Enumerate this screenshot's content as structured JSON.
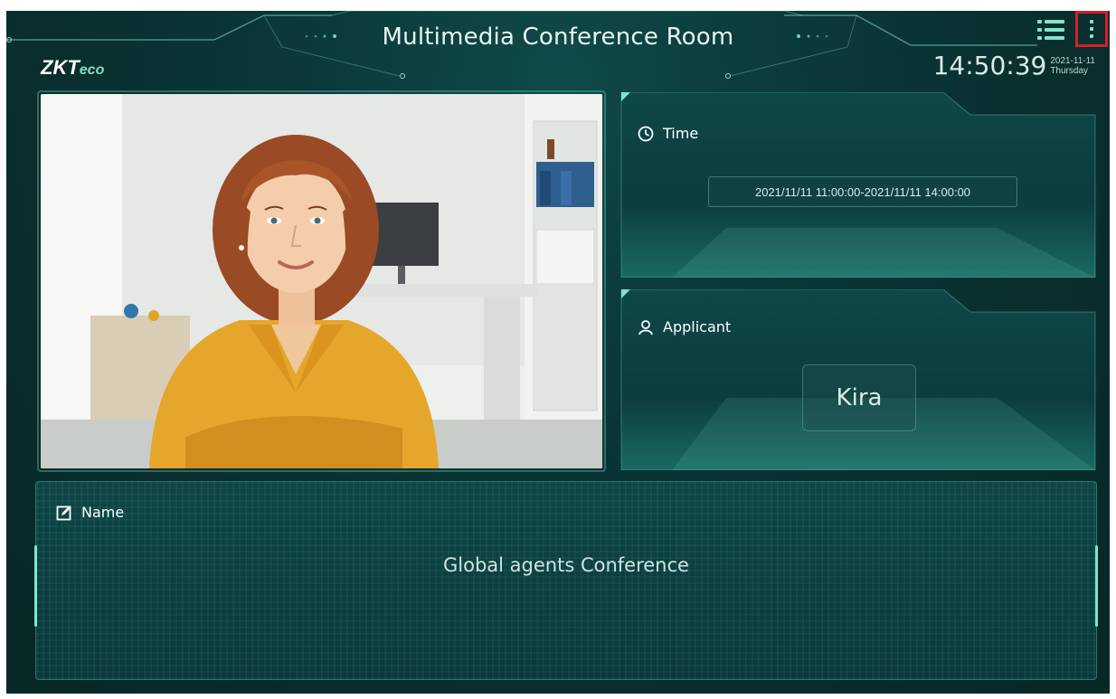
{
  "header": {
    "title": "Multimedia Conference Room",
    "logo_main": "ZKT",
    "logo_sub": "eco",
    "clock_time": "14:50:39",
    "clock_date": "2021-11-11",
    "clock_weekday": "Thursday",
    "menu_icon": "menu-list-icon",
    "more_icon": "more-vertical-icon"
  },
  "time_panel": {
    "label": "Time",
    "icon": "clock-icon",
    "value": "2021/11/11 11:00:00-2021/11/11 14:00:00"
  },
  "applicant_panel": {
    "label": "Applicant",
    "icon": "person-icon",
    "value": "Kira"
  },
  "name_panel": {
    "label": "Name",
    "icon": "edit-icon",
    "value": "Global agents Conference"
  },
  "colors": {
    "background": "#0b3a3a",
    "accent": "#7fe6cc",
    "highlight_border": "#d3202a"
  }
}
